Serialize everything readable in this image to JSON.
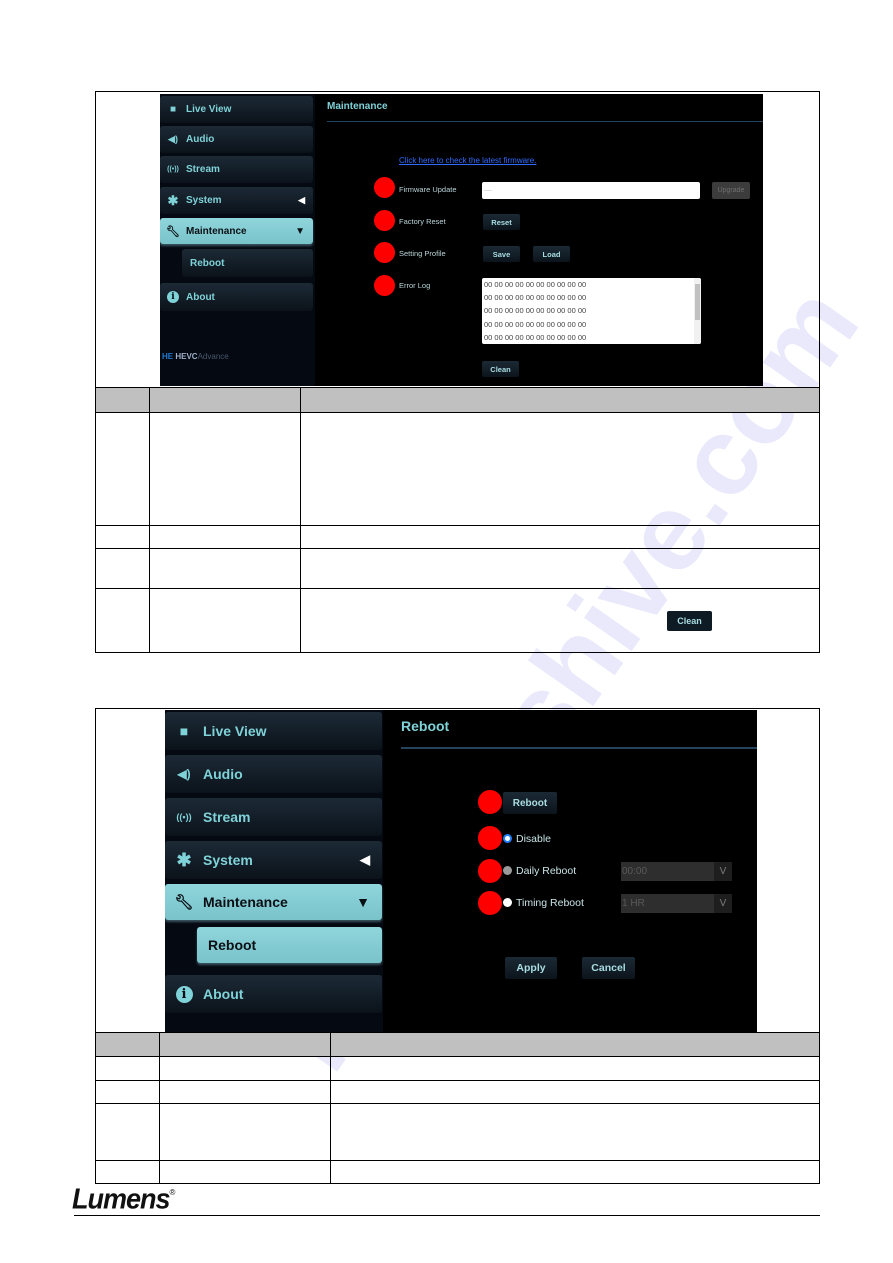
{
  "screen1": {
    "sidebar": {
      "items": [
        {
          "label": "Live View",
          "icon": "video-camera-icon"
        },
        {
          "label": "Audio",
          "icon": "speaker-icon"
        },
        {
          "label": "Stream",
          "icon": "broadcast-icon"
        },
        {
          "label": "System",
          "icon": "gear-icon",
          "caret": "◀"
        },
        {
          "label": "Maintenance",
          "icon": "wrench-icon",
          "caret": "▼",
          "active": true
        },
        {
          "label": "Reboot",
          "sub": true
        },
        {
          "label": "About",
          "icon": "info-icon"
        }
      ],
      "logo_text": "HEVC",
      "logo_sub": "Advance"
    },
    "title": "Maintenance",
    "firmware_link": "Click here to check the latest firmware.",
    "rows": {
      "firmware_label": "Firmware Update",
      "firmware_value": "....",
      "upgrade_label": "Upgrade",
      "factory_label": "Factory Reset",
      "reset_label": "Reset",
      "profile_label": "Setting Profile",
      "save_label": "Save",
      "load_label": "Load",
      "errorlog_label": "Error Log",
      "errorlog_lines": [
        "00 00 00 00 00 00 00 00 00 00",
        "00 00 00 00 00 00 00 00 00 00",
        "00 00 00 00 00 00 00 00 00 00",
        "00 00 00 00 00 00 00 00 00 00",
        "00 00 00 00 00 00 00 00 00 00"
      ],
      "clean_label": "Clean"
    }
  },
  "table1": {
    "inline_button": "Clean"
  },
  "screen2": {
    "sidebar": {
      "items": [
        {
          "label": "Live View"
        },
        {
          "label": "Audio"
        },
        {
          "label": "Stream"
        },
        {
          "label": "System",
          "caret": "◀"
        },
        {
          "label": "Maintenance",
          "caret": "▼"
        },
        {
          "label": "Reboot"
        },
        {
          "label": "About"
        }
      ]
    },
    "title": "Reboot",
    "reboot_button": "Reboot",
    "options": [
      {
        "label": "Disable",
        "selected": true
      },
      {
        "label": "Daily Reboot",
        "selected": false,
        "value": "00:00"
      },
      {
        "label": "Timing Reboot",
        "selected": false,
        "value": "1 HR"
      }
    ],
    "apply_label": "Apply",
    "cancel_label": "Cancel",
    "select_arrow": "V"
  },
  "footer": {
    "brand": "Lumens",
    "registered": "®"
  },
  "watermark": "manualshive.com",
  "colors": {
    "accent_teal": "#7fd2d8",
    "marker_red": "#ff0000",
    "link_blue": "#2f6bff",
    "header_gray": "#c0c0c0"
  }
}
